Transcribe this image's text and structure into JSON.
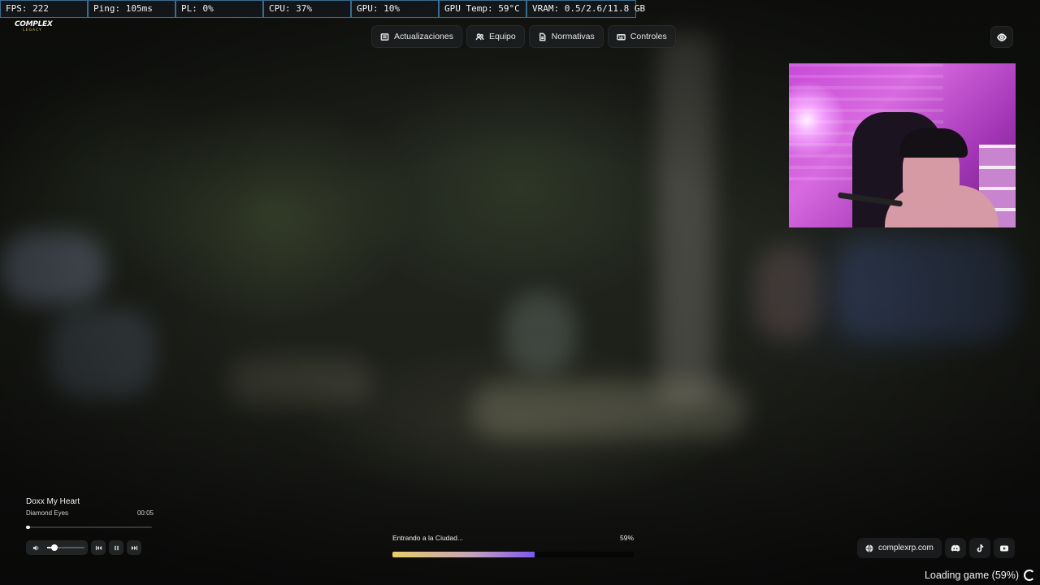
{
  "stats": [
    {
      "label": "FPS: 222"
    },
    {
      "label": "Ping: 105ms"
    },
    {
      "label": "PL: 0%"
    },
    {
      "label": "CPU: 37%"
    },
    {
      "label": "GPU: 10%"
    },
    {
      "label": "GPU Temp: 59°C"
    },
    {
      "label": "VRAM: 0.5/2.6/11.8 GB"
    }
  ],
  "logo": {
    "line1": "COMPLEX",
    "line2": "LEGACY"
  },
  "nav": [
    {
      "label": "Actualizaciones",
      "icon": "newspaper-icon"
    },
    {
      "label": "Equipo",
      "icon": "users-icon"
    },
    {
      "label": "Normativas",
      "icon": "document-icon"
    },
    {
      "label": "Controles",
      "icon": "keyboard-icon"
    }
  ],
  "player": {
    "title": "Doxx My Heart",
    "artist": "Diamond Eyes",
    "time": "00:05",
    "seek_progress": 0.03,
    "volume": 0.2
  },
  "loading": {
    "label": "Entrando a la Ciudad...",
    "percent_text": "59%",
    "progress": 0.59
  },
  "socials": {
    "website": "complexrp.com",
    "buttons": [
      "discord-icon",
      "tiktok-icon",
      "youtube-icon"
    ]
  },
  "status": {
    "loading_game": "Loading game (59%)"
  },
  "colors": {
    "accent_start": "#e7cf6a",
    "accent_end": "#7d58f0",
    "stats_border": "#3b6c8f"
  }
}
